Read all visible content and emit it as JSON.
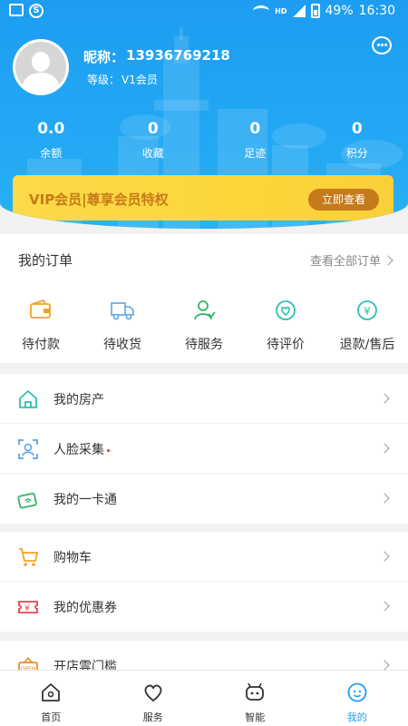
{
  "status_bar": {
    "battery": "49%",
    "time": "16:30"
  },
  "profile": {
    "nickname_label": "昵称：",
    "phone": "13936769218",
    "level_label": "等级：",
    "level_value": "V1会员"
  },
  "stats": [
    {
      "value": "0.0",
      "label": "余额"
    },
    {
      "value": "0",
      "label": "收藏"
    },
    {
      "value": "0",
      "label": "足迹"
    },
    {
      "value": "0",
      "label": "积分"
    }
  ],
  "vip": {
    "title": "VIP会员|尊享会员特权",
    "button": "立即查看"
  },
  "orders": {
    "title": "我的订单",
    "view_all": "查看全部订单",
    "items": [
      {
        "label": "待付款",
        "icon": "wallet-icon"
      },
      {
        "label": "待收货",
        "icon": "truck-icon"
      },
      {
        "label": "待服务",
        "icon": "service-person-icon"
      },
      {
        "label": "待评价",
        "icon": "review-icon"
      },
      {
        "label": "退款/售后",
        "icon": "refund-icon"
      }
    ]
  },
  "menu_group1": [
    {
      "label": "我的房产",
      "icon": "house-icon"
    },
    {
      "label": "人脸采集",
      "icon": "face-scan-icon"
    },
    {
      "label": "我的一卡通",
      "icon": "card-icon"
    }
  ],
  "menu_group2": [
    {
      "label": "购物车",
      "icon": "cart-icon"
    },
    {
      "label": "我的优惠券",
      "icon": "coupon-icon"
    }
  ],
  "menu_group3": [
    {
      "label": "开店雲门槛",
      "icon": "open-store-icon"
    }
  ],
  "tabs": [
    {
      "label": "首页",
      "icon": "home-icon"
    },
    {
      "label": "服务",
      "icon": "heart-icon"
    },
    {
      "label": "智能",
      "icon": "robot-icon"
    },
    {
      "label": "我的",
      "icon": "me-icon"
    }
  ],
  "colors": {
    "primary": "#1d9df1",
    "vip_gold": "#fbd94a",
    "vip_text": "#c77a17"
  }
}
